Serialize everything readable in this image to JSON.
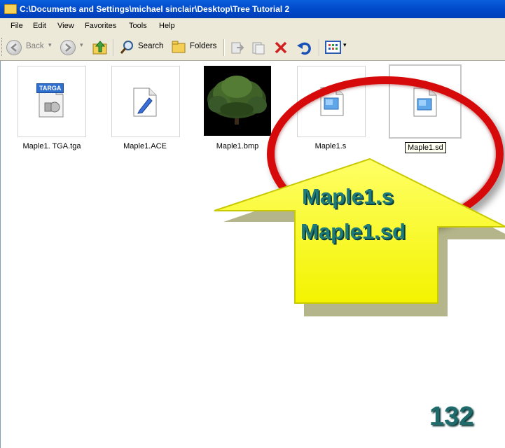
{
  "window": {
    "title": "C:\\Documents and Settings\\michael sinclair\\Desktop\\Tree Tutorial 2"
  },
  "menu": [
    "File",
    "Edit",
    "View",
    "Favorites",
    "Tools",
    "Help"
  ],
  "toolbar": {
    "back": "Back",
    "search": "Search",
    "folders": "Folders"
  },
  "files": [
    {
      "name": "Maple1. TGA.tga",
      "badge": "TARGA"
    },
    {
      "name": "Maple1.ACE"
    },
    {
      "name": "Maple1.bmp"
    },
    {
      "name": "Maple1.s"
    },
    {
      "name": "Maple1.sd"
    }
  ],
  "callout": {
    "line1": "Maple1.s",
    "line2": "Maple1.sd"
  },
  "page_number": "132",
  "colors": {
    "highlight_ring": "#d60a0a",
    "arrow": "#ffff22",
    "callout_text": "#1f7a7a"
  }
}
